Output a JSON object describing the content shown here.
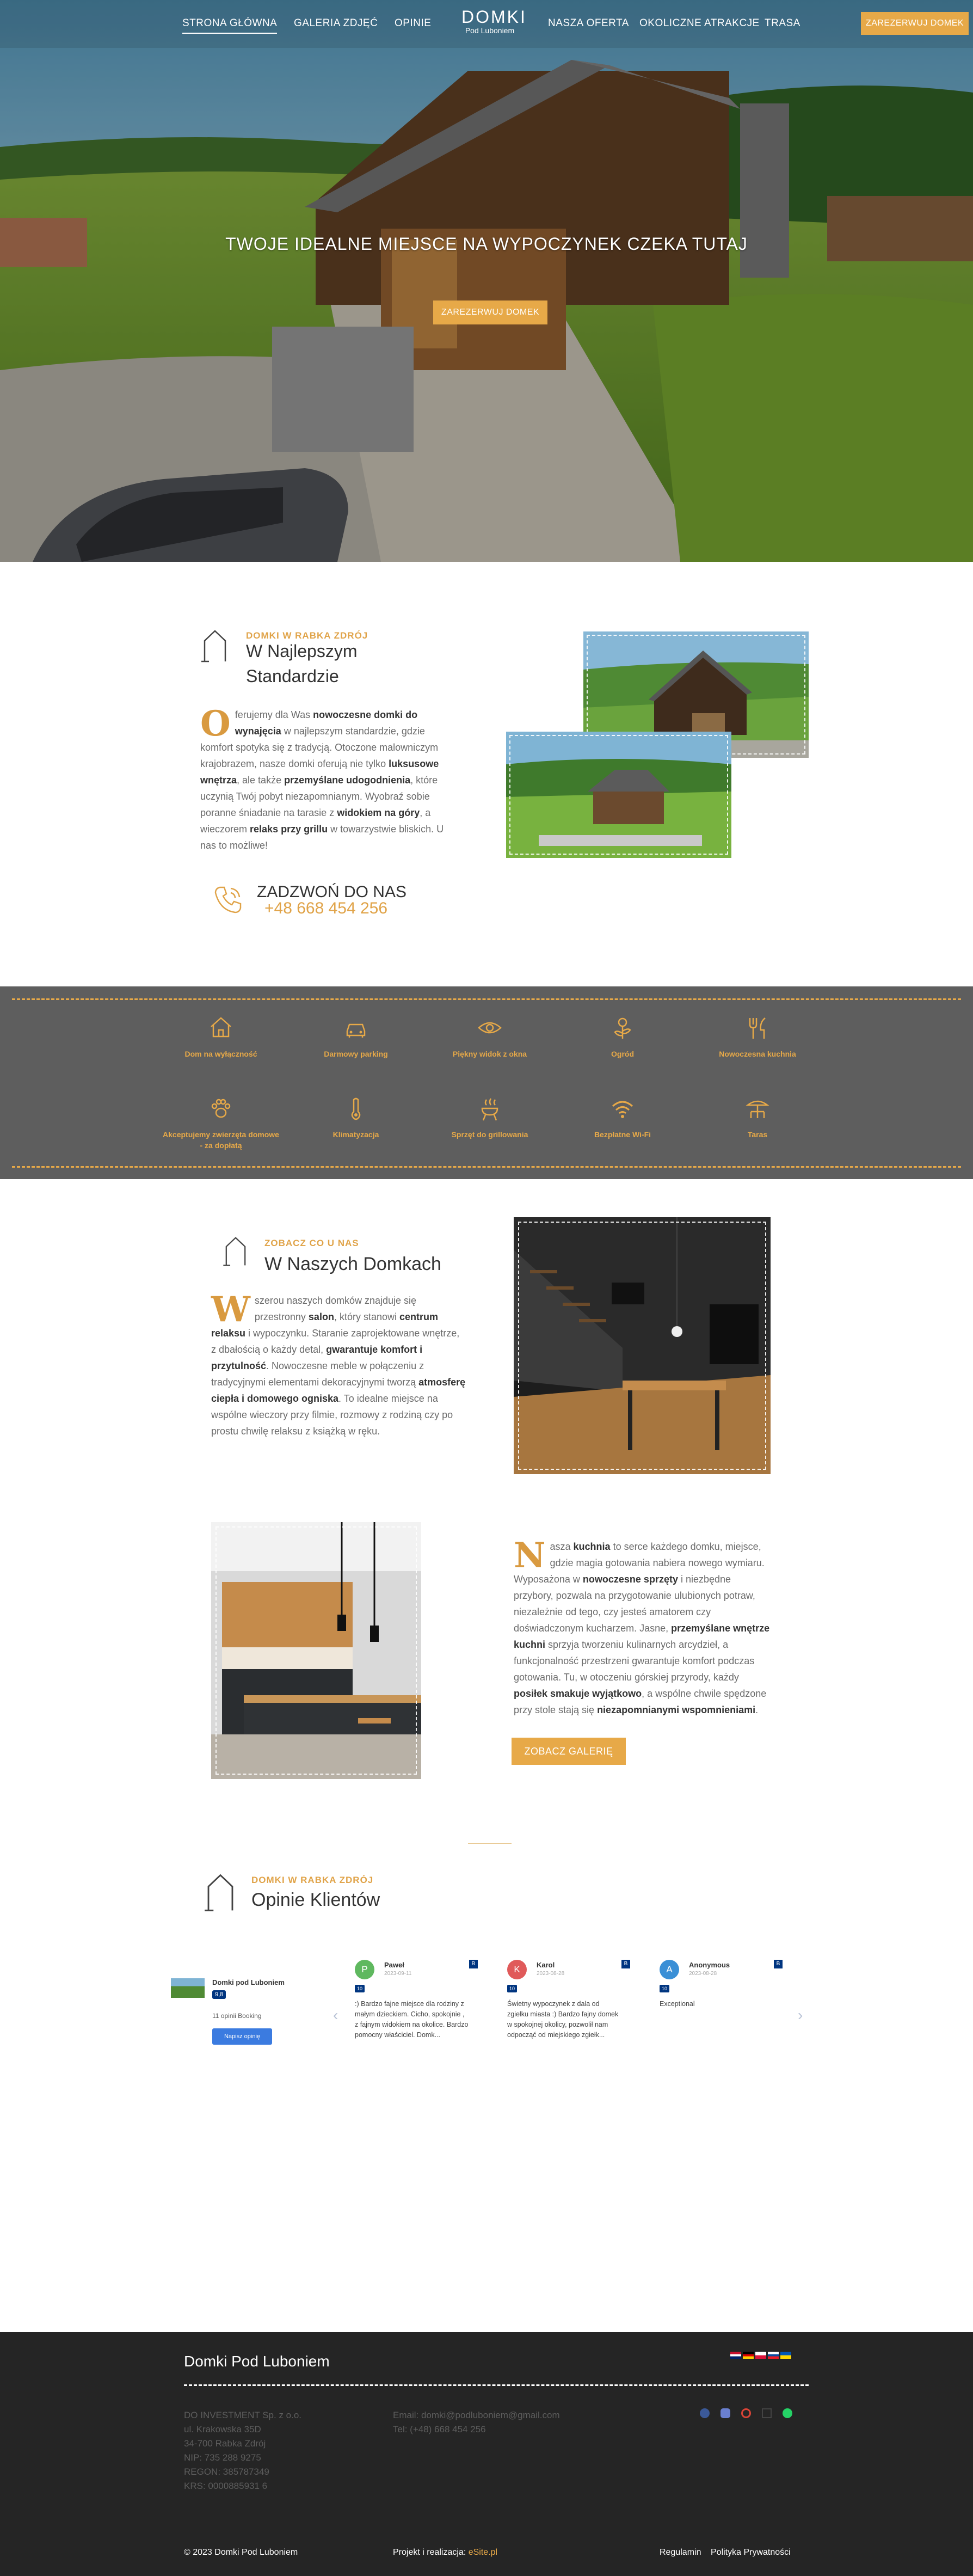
{
  "nav": {
    "items": [
      "STRONA GŁÓWNA",
      "GALERIA ZDJĘĆ",
      "OPINIE",
      "NASZA OFERTA",
      "OKOLICZNE ATRAKCJE",
      "TRASA"
    ],
    "logo_line1": "DOMKI",
    "logo_line2": "Pod Luboniem",
    "cta": "ZAREZERWUJ DOMEK"
  },
  "hero": {
    "headline": "TWOJE IDEALNE MIEJSCE NA WYPOCZYNEK CZEKA TUTAJ",
    "cta": "ZAREZERWUJ DOMEK"
  },
  "about": {
    "kicker": "DOMKI W RABKA ZDRÓJ",
    "title_line1": "W Najlepszym",
    "title_line2": "Standardzie",
    "drop": "O",
    "p": [
      {
        "t": "ferujemy dla Was ",
        "b": false
      },
      {
        "t": "nowoczesne domki do wynajęcia",
        "b": true
      },
      {
        "t": " w najlepszym standardzie, gdzie komfort spotyka się z tradycją. Otoczone malowniczym krajobrazem, nasze domki oferują nie tylko ",
        "b": false
      },
      {
        "t": "luksusowe wnętrza",
        "b": true
      },
      {
        "t": ", ale także ",
        "b": false
      },
      {
        "t": "przemyślane udogodnienia",
        "b": true
      },
      {
        "t": ", które uczynią Twój pobyt niezapomnianym. Wyobraź sobie poranne śniadanie na tarasie z ",
        "b": false
      },
      {
        "t": "widokiem na góry",
        "b": true
      },
      {
        "t": ", a wieczorem ",
        "b": false
      },
      {
        "t": "relaks przy grillu",
        "b": true
      },
      {
        "t": " w towarzystwie bliskich. U nas to możliwe!",
        "b": false
      }
    ],
    "call_label": "ZADZWOŃ DO NAS",
    "phone": "+48 668 454 256"
  },
  "amenities": [
    {
      "label": "Dom na wyłączność",
      "icon": "house-icon"
    },
    {
      "label": "Darmowy parking",
      "icon": "car-icon"
    },
    {
      "label": "Piękny widok z okna",
      "icon": "eye-icon"
    },
    {
      "label": "Ogród",
      "icon": "flower-icon"
    },
    {
      "label": "Nowoczesna kuchnia",
      "icon": "cutlery-icon"
    },
    {
      "label": "Akceptujemy zwierzęta domowe - za dopłatą",
      "icon": "paw-icon"
    },
    {
      "label": "Klimatyzacja",
      "icon": "thermometer-icon"
    },
    {
      "label": "Sprzęt do grillowania",
      "icon": "grill-icon"
    },
    {
      "label": "Bezpłatne Wi-Fi",
      "icon": "wifi-icon"
    },
    {
      "label": "Taras",
      "icon": "terrace-icon"
    }
  ],
  "inside": {
    "kicker": "ZOBACZ CO U NAS",
    "title": "W Naszych Domkach",
    "drop": "W",
    "p": [
      {
        "t": "szerou naszych domków znajduje się przestronny ",
        "b": false
      },
      {
        "t": "salon",
        "b": true
      },
      {
        "t": ", który stanowi ",
        "b": false
      },
      {
        "t": "centrum relaksu",
        "b": true
      },
      {
        "t": " i wypoczynku. Staranie zaprojektowane wnętrze, z dbałością o każdy detal, ",
        "b": false
      },
      {
        "t": "gwarantuje komfort i przytulność",
        "b": true
      },
      {
        "t": ". Nowoczesne meble w połączeniu z tradycyjnymi elementami dekoracyjnymi tworzą ",
        "b": false
      },
      {
        "t": "atmosferę ciepła i domowego ogniska",
        "b": true
      },
      {
        "t": ". To idealne miejsce na wspólne wieczory przy filmie, rozmowy z rodziną czy po prostu chwilę relaksu z książką w ręku.",
        "b": false
      }
    ]
  },
  "kitchen": {
    "drop": "N",
    "p": [
      {
        "t": "asza ",
        "b": false
      },
      {
        "t": "kuchnia",
        "b": true
      },
      {
        "t": " to serce każdego domku, miejsce, gdzie magia gotowania nabiera nowego wymiaru. Wyposażona w ",
        "b": false
      },
      {
        "t": "nowoczesne sprzęty",
        "b": true
      },
      {
        "t": " i niezbędne przybory, pozwala na przygotowanie ulubionych potraw, niezależnie od tego, czy jesteś amatorem czy doświadczonym kucharzem. Jasne, ",
        "b": false
      },
      {
        "t": "przemyślane wnętrze kuchni",
        "b": true
      },
      {
        "t": " sprzyja tworzeniu kulinarnych arcydzieł, a funkcjonalność przestrzeni gwarantuje komfort podczas gotowania. Tu, w otoczeniu górskiej przyrody, każdy ",
        "b": false
      },
      {
        "t": "posiłek smakuje wyjątkowo",
        "b": true
      },
      {
        "t": ", a wspólne chwile spędzone przy stole stają się ",
        "b": false
      },
      {
        "t": "niezapomnianymi wspomnieniami",
        "b": true
      },
      {
        "t": ".",
        "b": false
      }
    ],
    "cta": "ZOBACZ GALERIĘ"
  },
  "reviews": {
    "kicker": "DOMKI W RABKA ZDRÓJ",
    "title": "Opinie Klientów",
    "summary": {
      "name": "Domki pod Luboniem",
      "score": "9,8",
      "count": "11 opinii Booking",
      "cta": "Napisz opinię"
    },
    "items": [
      {
        "initial": "P",
        "name": "Paweł",
        "date": "2023-09-11",
        "score": "10",
        "text": ":) Bardzo fajne miejsce dla rodziny z małym dzieckiem. Cicho, spokojnie , z fajnym widokiem na okolice. Bardzo pomocny właściciel. Domk...",
        "color": "#5fb85f"
      },
      {
        "initial": "K",
        "name": "Karol",
        "date": "2023-08-28",
        "score": "10",
        "text": "Świetny wypoczynek z dala od zgiełku miasta :) Bardzo fajny domek w spokojnej okolicy, pozwolił nam odpocząć od miejskiego zgiełk...",
        "color": "#e05a5a"
      },
      {
        "initial": "A",
        "name": "Anonymous",
        "date": "2023-08-28",
        "score": "10",
        "text": "Exceptional",
        "color": "#3a8fd6"
      }
    ]
  },
  "footer": {
    "title": "Domki Pod Luboniem",
    "company": [
      "DO INVESTMENT Sp. z o.o.",
      "ul. Krakowska 35D",
      "34-700 Rabka Zdrój",
      "NIP: 735 288 9275",
      "REGON: 385787349",
      "KRS: 0000885931 6"
    ],
    "email": "Email: domki@podluboniem@gmail.com",
    "tel": "Tel: (+48) 668 454 256",
    "copyright": "© 2023 Domki Pod Luboniem",
    "credit_label": "Projekt i realizacja:",
    "credit_link": "eSite.pl",
    "links": [
      "Regulamin",
      "Polityka Prywatności"
    ]
  },
  "colors": {
    "gold": "#e7a948",
    "dark": "#252525",
    "gray": "#5e5e5e"
  }
}
